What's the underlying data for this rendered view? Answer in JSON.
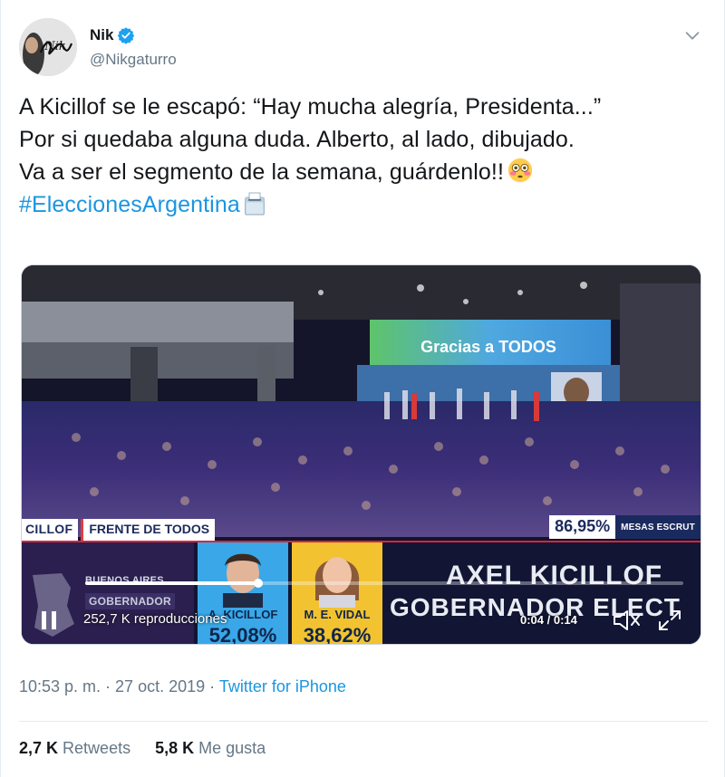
{
  "author": {
    "name": "Nik",
    "handle": "@Nikgaturro",
    "avatar_text": "Nik",
    "verified_icon": "verified-badge-icon",
    "verified_color": "#1da1f2"
  },
  "tweet": {
    "line1": "A Kicillof se le escapó: “Hay mucha alegría, Presidenta...”",
    "line2": "Por si quedaba alguna duda. Alberto, al lado, dibujado.",
    "line3": "Va a ser el segmento de la semana, guárdenlo!!",
    "line3_emoji": "flushed-face-emoji",
    "hashtag": "#EleccionesArgentina",
    "hashtag_emoji": "ballot-box-emoji",
    "hashtag_color": "#1b95e0"
  },
  "video": {
    "stage_screen_text": "Gracias a TODOS",
    "lower_third": {
      "name": "CILLOF",
      "party": "FRENTE DE TODOS",
      "percent": "86,95%",
      "percent_label": "MESAS ESCRUT"
    },
    "ticker": {
      "province": "BUENOS AIRES",
      "office": "GOBERNADOR",
      "candidates": [
        {
          "name": "A. KICILLOF",
          "percent": "52,08%"
        },
        {
          "name": "M. E. VIDAL",
          "percent": "38,62%"
        }
      ],
      "headline1": "AXEL KICILLOF",
      "headline2": "GOBERNADOR ELECT"
    },
    "progress": 0.29,
    "views": "252,7 K reproducciones",
    "time": "0:04 / 0:14"
  },
  "meta": {
    "timestamp": "10:53 p. m. · 27 oct. 2019 · ",
    "source": "Twitter for iPhone"
  },
  "stats": {
    "retweets_count": "2,7 K",
    "retweets_label": "Retweets",
    "likes_count": "5,8 K",
    "likes_label": "Me gusta"
  }
}
